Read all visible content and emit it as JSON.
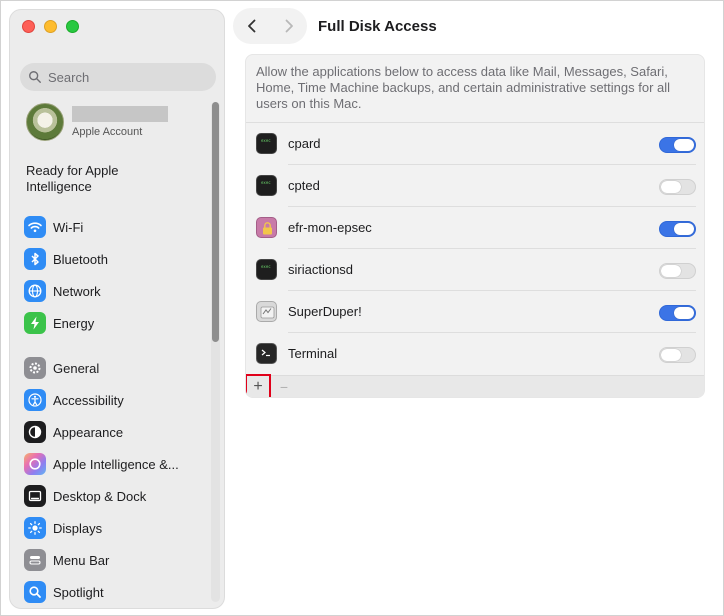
{
  "window": {
    "title": "Full Disk Access"
  },
  "sidebar": {
    "search_placeholder": "Search",
    "account": {
      "subtitle": "Apple Account"
    },
    "ready_text": "Ready for Apple Intelligence",
    "items": [
      {
        "label": "Wi-Fi",
        "icon": "wifi-icon",
        "color": "#2f8cf5"
      },
      {
        "label": "Bluetooth",
        "icon": "bluetooth-icon",
        "color": "#2f8cf5"
      },
      {
        "label": "Network",
        "icon": "globe-icon",
        "color": "#2f8cf5"
      },
      {
        "label": "Energy",
        "icon": "bolt-icon",
        "color": "#3bc34a"
      },
      {
        "label": "General",
        "icon": "gear-icon",
        "color": "#8e8e93"
      },
      {
        "label": "Accessibility",
        "icon": "accessibility-icon",
        "color": "#2f8cf5"
      },
      {
        "label": "Appearance",
        "icon": "appearance-icon",
        "color": "#1d1d1f"
      },
      {
        "label": "Apple Intelligence &...",
        "icon": "apple-intelligence-icon",
        "color": "#d88bd8"
      },
      {
        "label": "Desktop & Dock",
        "icon": "dock-icon",
        "color": "#1d1d1f"
      },
      {
        "label": "Displays",
        "icon": "sun-icon",
        "color": "#2f8cf5"
      },
      {
        "label": "Menu Bar",
        "icon": "menubar-icon",
        "color": "#8e8e93"
      },
      {
        "label": "Spotlight",
        "icon": "spotlight-icon",
        "color": "#2f8cf5"
      }
    ]
  },
  "main": {
    "description": "Allow the applications below to access data like Mail, Messages, Safari, Home, Time Machine backups, and certain administrative settings for all users on this Mac.",
    "apps": [
      {
        "name": "cpard",
        "enabled": true,
        "icon": "terminal-dark-icon"
      },
      {
        "name": "cpted",
        "enabled": false,
        "icon": "terminal-dark-icon"
      },
      {
        "name": "efr-mon-epsec",
        "enabled": true,
        "icon": "lock-icon"
      },
      {
        "name": "siriactionsd",
        "enabled": false,
        "icon": "terminal-dark-icon"
      },
      {
        "name": "SuperDuper!",
        "enabled": true,
        "icon": "superduper-icon"
      },
      {
        "name": "Terminal",
        "enabled": false,
        "icon": "terminal-icon"
      }
    ],
    "add_label": "+",
    "remove_label": "−"
  },
  "colors": {
    "accent": "#3b74e6",
    "highlight": "#e0001a"
  }
}
